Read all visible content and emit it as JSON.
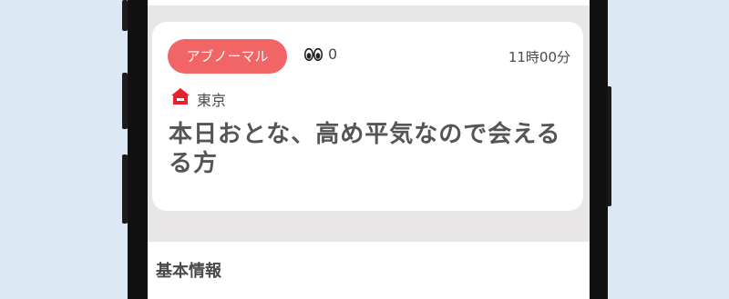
{
  "post": {
    "category_tag": "アブノーマル",
    "view_count": "0",
    "duration": "11時00分",
    "location": "東京",
    "title": "本日おとな、高め平気なので会えるる方"
  },
  "sections": {
    "basic_info": "基本情報"
  },
  "colors": {
    "accent": "#f26566",
    "location_icon": "#e8202a",
    "background": "#dce8f4",
    "screen_bg": "#e8e6e7"
  },
  "icons": {
    "views": "eyes-icon",
    "location": "home-icon"
  }
}
